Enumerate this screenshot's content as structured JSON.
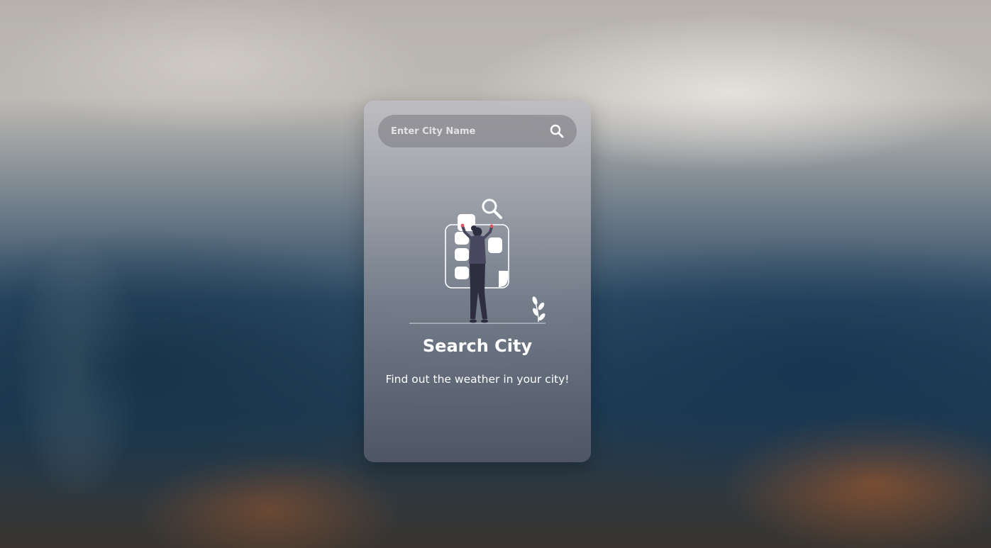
{
  "search": {
    "placeholder": "Enter City Name",
    "value": "",
    "icon": "search-icon"
  },
  "empty_state": {
    "illustration": "person-searching-illustration",
    "title": "Search City",
    "subtitle": "Find out the weather in your city!"
  },
  "colors": {
    "text": "#ffffff",
    "accent": "#e0535f"
  }
}
